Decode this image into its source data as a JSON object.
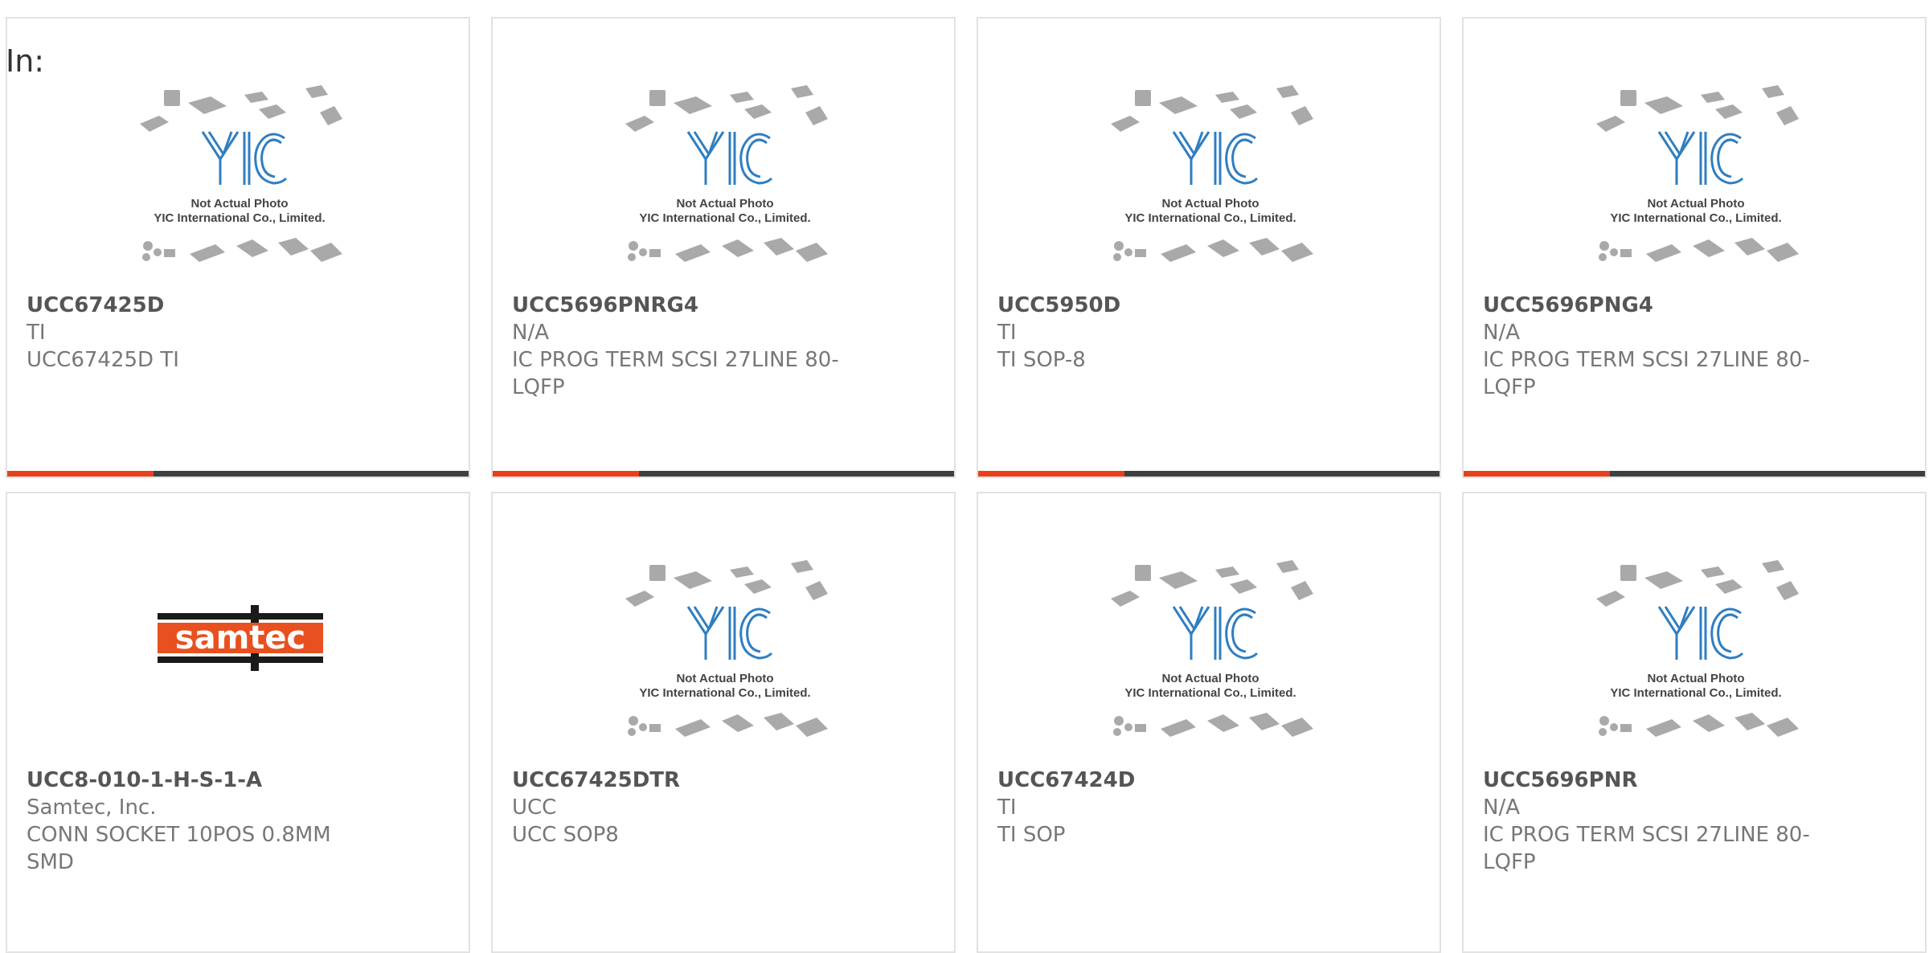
{
  "filter": {
    "label": "In:"
  },
  "placeholder_image": {
    "brand": "YIC",
    "line1": "Not Actual Photo",
    "line2": "YIC International Co., Limited."
  },
  "samtec_logo_text": "samtec",
  "colors": {
    "accent": "#e8411a",
    "bar": "#3f3f3f",
    "yic_blue": "#2f7ec1",
    "samtec_orange": "#e8511f"
  },
  "products": [
    {
      "part_number": "UCC67425D",
      "manufacturer": "TI",
      "description": "UCC67425D TI",
      "image": "yic-placeholder"
    },
    {
      "part_number": "UCC5696PNRG4",
      "manufacturer": "N/A",
      "description": "IC PROG TERM SCSI 27LINE 80-LQFP",
      "image": "yic-placeholder"
    },
    {
      "part_number": "UCC5950D",
      "manufacturer": "TI",
      "description": "TI SOP-8",
      "image": "yic-placeholder"
    },
    {
      "part_number": "UCC5696PNG4",
      "manufacturer": "N/A",
      "description": "IC PROG TERM SCSI 27LINE 80-LQFP",
      "image": "yic-placeholder"
    },
    {
      "part_number": "UCC8-010-1-H-S-1-A",
      "manufacturer": "Samtec, Inc.",
      "description": "CONN SOCKET 10POS 0.8MM SMD",
      "image": "samtec-logo"
    },
    {
      "part_number": "UCC67425DTR",
      "manufacturer": "UCC",
      "description": "UCC SOP8",
      "image": "yic-placeholder"
    },
    {
      "part_number": "UCC67424D",
      "manufacturer": "TI",
      "description": "TI SOP",
      "image": "yic-placeholder"
    },
    {
      "part_number": "UCC5696PNR",
      "manufacturer": "N/A",
      "description": "IC PROG TERM SCSI 27LINE 80-LQFP",
      "image": "yic-placeholder"
    }
  ]
}
